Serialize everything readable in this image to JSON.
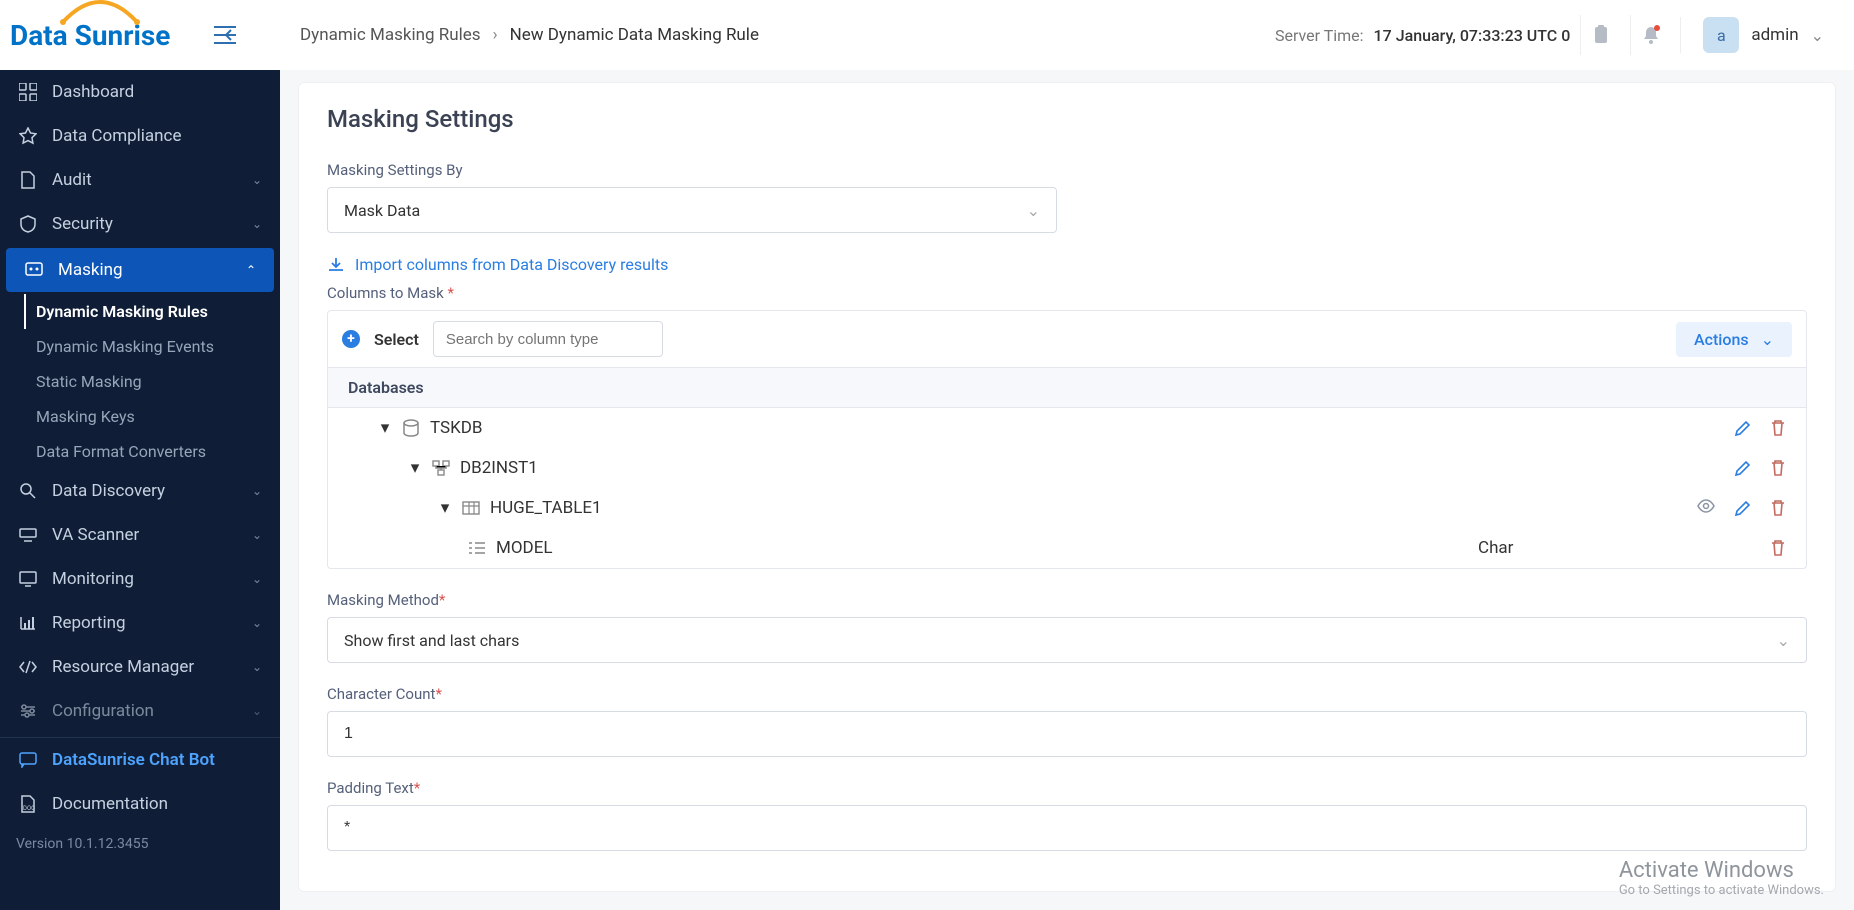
{
  "logo": {
    "part1": "Data",
    "part2": "Sunrise"
  },
  "breadcrumb": {
    "parent": "Dynamic Masking Rules",
    "sep": "›",
    "current": "New Dynamic Data Masking Rule"
  },
  "server_time": {
    "label": "Server Time:",
    "value": "17 January, 07:33:23  UTC 0"
  },
  "user": {
    "initial": "a",
    "name": "admin"
  },
  "sidebar": {
    "items": [
      {
        "label": "Dashboard"
      },
      {
        "label": "Data Compliance"
      },
      {
        "label": "Audit"
      },
      {
        "label": "Security"
      },
      {
        "label": "Masking"
      },
      {
        "label": "Data Discovery"
      },
      {
        "label": "VA Scanner"
      },
      {
        "label": "Monitoring"
      },
      {
        "label": "Reporting"
      },
      {
        "label": "Resource Manager"
      },
      {
        "label": "Configuration"
      }
    ],
    "masking_sub": [
      {
        "label": "Dynamic Masking Rules"
      },
      {
        "label": "Dynamic Masking Events"
      },
      {
        "label": "Static Masking"
      },
      {
        "label": "Masking Keys"
      },
      {
        "label": "Data Format Converters"
      }
    ],
    "chat": "DataSunrise Chat Bot",
    "docs": "Documentation",
    "version": "Version 10.1.12.3455"
  },
  "form": {
    "section_title": "Masking Settings",
    "settings_by_label": "Masking Settings By",
    "settings_by_value": "Mask Data",
    "import_link": "Import columns from Data Discovery results",
    "columns_to_mask_label": "Columns to Mask",
    "select_label": "Select",
    "search_placeholder": "Search by column type",
    "actions_label": "Actions",
    "databases_header": "Databases",
    "tree": {
      "db": "TSKDB",
      "schema": "DB2INST1",
      "table": "HUGE_TABLE1",
      "column": "MODEL",
      "column_type": "Char"
    },
    "masking_method_label": "Masking Method",
    "masking_method_value": "Show first and last chars",
    "char_count_label": "Character Count",
    "char_count_value": "1",
    "padding_text_label": "Padding Text",
    "padding_text_value": "*"
  },
  "watermark": {
    "line1": "Activate Windows",
    "line2": "Go to Settings to activate Windows."
  }
}
